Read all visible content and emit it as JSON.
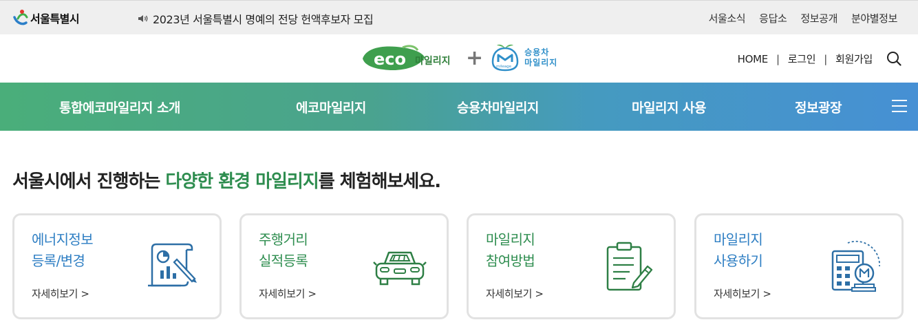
{
  "topbar": {
    "logo_text": "서울특별시",
    "notice": "2023년 서울특별시 명예의 전당 헌액후보자 모집",
    "links": [
      "서울소식",
      "응답소",
      "정보공개",
      "분야별정보"
    ]
  },
  "header": {
    "eco_logo_text": "eco",
    "eco_logo_sub": "마일리지",
    "plus": "+",
    "car_logo_line1": "승용차",
    "car_logo_line2": "마일리지",
    "car_logo_badge": "mileage",
    "links": [
      "HOME",
      "로그인",
      "회원가입"
    ],
    "separator": "|"
  },
  "gnb": {
    "items": [
      "통합에코마일리지 소개",
      "에코마일리지",
      "승용차마일리지",
      "마일리지 사용",
      "정보광장"
    ]
  },
  "main": {
    "heading_pre": "서울시에서 진행하는 ",
    "heading_highlight": "다양한 환경 마일리지",
    "heading_post": "를 체험해보세요.",
    "cards": [
      {
        "line1": "에너지정보",
        "line2": "등록/변경",
        "more": "자세히보기 >",
        "icon": "energy-report-icon"
      },
      {
        "line1": "주행거리",
        "line2": "실적등록",
        "more": "자세히보기 >",
        "icon": "car-icon"
      },
      {
        "line1": "마일리지",
        "line2": "참여방법",
        "more": "자세히보기 >",
        "icon": "clipboard-pen-icon"
      },
      {
        "line1": "마일리지",
        "line2": "사용하기",
        "more": "자세히보기 >",
        "icon": "calculator-coin-icon"
      }
    ]
  },
  "colors": {
    "gnb_start": "#4aae7a",
    "gnb_end": "#4690d4",
    "highlight_green": "#2e8d4f",
    "card_blue": "#2d7ec3"
  }
}
